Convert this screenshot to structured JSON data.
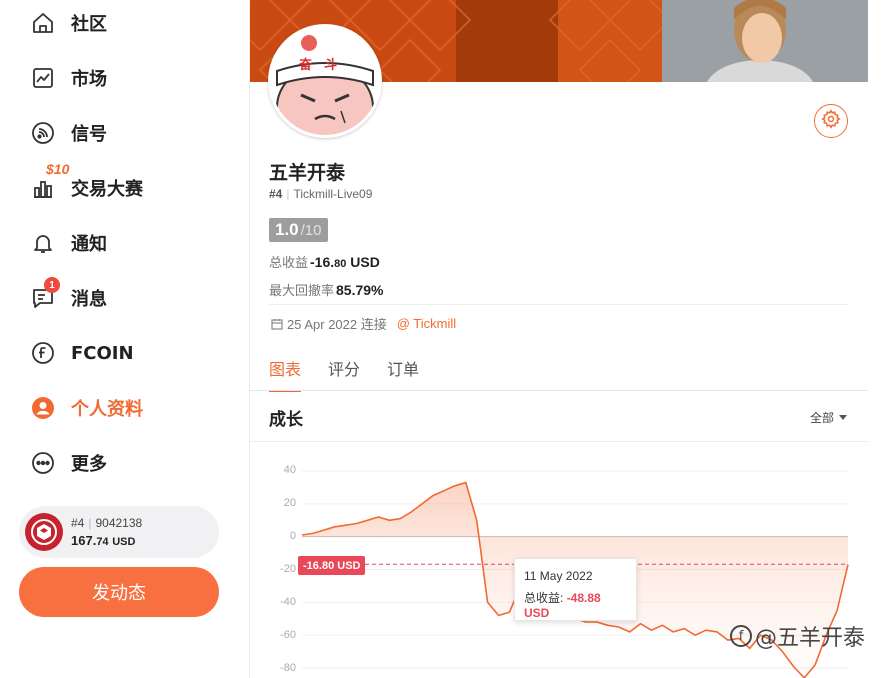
{
  "sidebar": {
    "items": [
      {
        "label": "社区",
        "icon": "home-icon"
      },
      {
        "label": "市场",
        "icon": "market-chart-icon"
      },
      {
        "label": "信号",
        "icon": "signal-rss-icon"
      },
      {
        "label": "交易大赛",
        "icon": "contest-bar-icon",
        "badge": "$10"
      },
      {
        "label": "通知",
        "icon": "bell-icon"
      },
      {
        "label": "消息",
        "icon": "message-icon",
        "badge": "1"
      },
      {
        "label": "FCOIN",
        "icon": "fcoin-icon"
      },
      {
        "label": "个人资料",
        "icon": "profile-icon",
        "active": true
      },
      {
        "label": "更多",
        "icon": "more-icon"
      }
    ],
    "account": {
      "rank": "#4",
      "id": "9042138",
      "balance_int": "167.",
      "balance_dec": "74",
      "currency": "USD"
    },
    "post_button": "发动态"
  },
  "profile": {
    "avatar_text": "奋斗",
    "name": "五羊开泰",
    "rank": "#4",
    "account": "Tickmill-Live09",
    "score": "1.0",
    "score_max": "/10",
    "total_profit_label": "总收益",
    "total_profit_int": "-16.",
    "total_profit_dec": "80",
    "total_profit_currency": "USD",
    "max_drawdown_label": "最大回撤率",
    "max_drawdown": "85.79%",
    "join_date": "25 Apr 2022 连接",
    "broker": "@ Tickmill"
  },
  "tabs": [
    "图表",
    "评分",
    "订单"
  ],
  "chart_section": {
    "title": "成长",
    "filter": "全部"
  },
  "chart_data": {
    "type": "area",
    "title": "成长",
    "ylim": [
      -80,
      40
    ],
    "yticks": [
      "40",
      "20",
      "0",
      "-20",
      "-40",
      "-60",
      "-80"
    ],
    "y": [
      1,
      2,
      4,
      6,
      7,
      8,
      10,
      12,
      10,
      11,
      15,
      20,
      25,
      28,
      31,
      33,
      10,
      -40,
      -48,
      -46,
      -30,
      -34,
      -38,
      -50,
      -48,
      -50,
      -52,
      -52,
      -54,
      -55,
      -58,
      -53,
      -57,
      -54,
      -58,
      -56,
      -60,
      -57,
      -58,
      -63,
      -62,
      -68,
      -60,
      -63,
      -70,
      -79,
      -86,
      -78,
      -60,
      -45,
      -17
    ],
    "average_line": {
      "value": -16.8,
      "label": "-16.80 USD"
    },
    "tooltip": {
      "date": "11 May 2022",
      "label": "总收益:",
      "value": "-48.88 USD"
    },
    "line_color": "#f26a32",
    "grid": true
  },
  "watermark": "@五羊开泰"
}
